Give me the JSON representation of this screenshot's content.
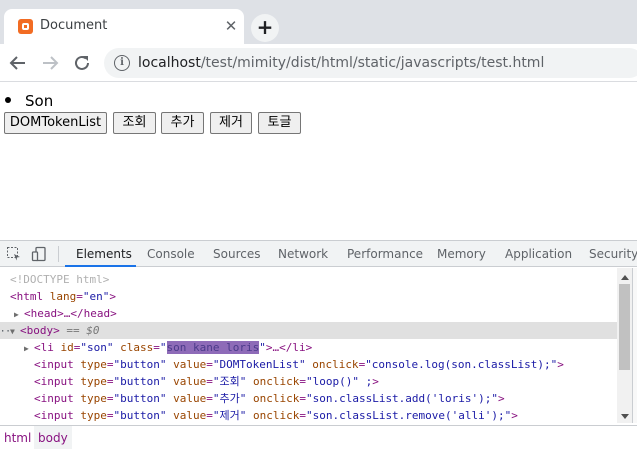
{
  "browser": {
    "tab_title": "Document",
    "tab_close": "✕",
    "new_tab": "+",
    "url_host": "localhost",
    "url_path": "/test/mimity/dist/html/static/javascripts/test.html",
    "info_icon": "i"
  },
  "page": {
    "list_item": "Son",
    "buttons": [
      "DOMTokenList",
      "조회",
      "추가",
      "제거",
      "토글"
    ]
  },
  "devtools": {
    "tabs": [
      "Elements",
      "Console",
      "Sources",
      "Network",
      "Performance",
      "Memory",
      "Application",
      "Security"
    ],
    "active_tab": "Elements",
    "dom": {
      "doctype": "<!DOCTYPE html>",
      "html_open": "<html",
      "html_attr": " lang",
      "html_val": "\"en\"",
      "html_close": ">",
      "head": "<head>…</head>",
      "body_dots": "···",
      "body_tag": "<body>",
      "body_eq": " == $0",
      "li_open": "<li",
      "li_id_attr": " id",
      "li_id_val": "\"son\"",
      "li_class_attr": " class",
      "li_class_q1": "\"",
      "li_class_val": "son kane loris",
      "li_class_q2": "\"",
      "li_end": ">…</li>",
      "inputs": [
        {
          "value": "\"DOMTokenList\"",
          "onclick": "\"console.log(son.classList);\""
        },
        {
          "value": "\"조회\"",
          "onclick": "\"loop()\" ;"
        },
        {
          "value": "\"추가\"",
          "onclick": "\"son.classList.add('loris');\""
        },
        {
          "value": "\"제거\"",
          "onclick": "\"son.classList.remove('alli');\""
        }
      ],
      "input_tag": "<input",
      "type_attr": " type",
      "type_val": "\"button\"",
      "value_attr": " value",
      "onclick_attr": " onclick",
      "tag_close": ">"
    },
    "breadcrumbs": [
      "html",
      "body"
    ]
  },
  "colors": {
    "accent": "#1a73e8",
    "selection_highlight": "#8e6bb8",
    "favicon": "#f26c23"
  }
}
